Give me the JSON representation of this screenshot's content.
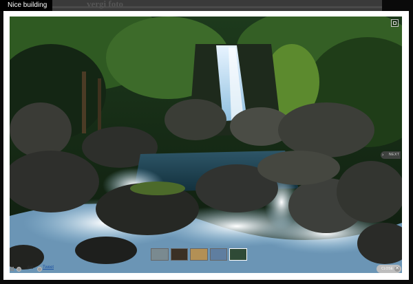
{
  "page": {
    "title": "Nice building",
    "background_heading": "vergi foto"
  },
  "viewer": {
    "next_label": "NEXT",
    "counter": "6/6",
    "tweet_label": "Tweet",
    "close_label": "CLOSE",
    "close_glyph": "✕",
    "next_glyph": "›",
    "thumbnails": [
      {
        "name": "thumb-1",
        "color": "#7a8a90",
        "active": false
      },
      {
        "name": "thumb-2",
        "color": "#3b3024",
        "active": false
      },
      {
        "name": "thumb-3",
        "color": "#b39055",
        "active": false
      },
      {
        "name": "thumb-4",
        "color": "#5f7ea0",
        "active": false
      },
      {
        "name": "thumb-5",
        "color": "#2f4a36",
        "active": true
      }
    ],
    "icons": [
      "expand-icon",
      "pause-icon",
      "prev-icon",
      "next-small-icon",
      "close-icon",
      "next-arrow-icon"
    ]
  }
}
